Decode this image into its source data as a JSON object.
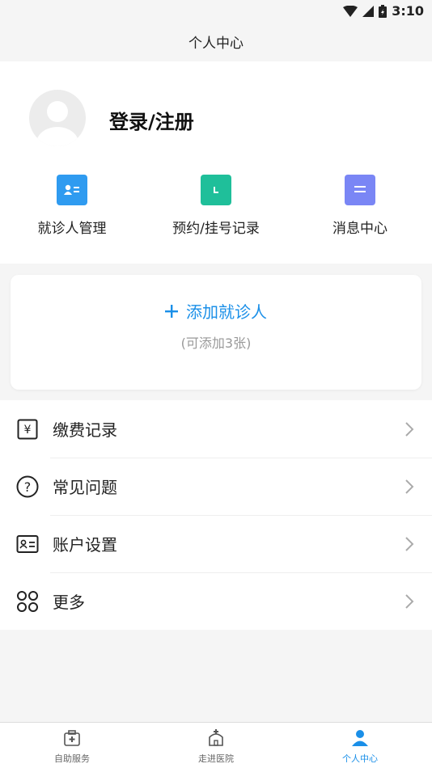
{
  "status": {
    "time": "3:10"
  },
  "header": {
    "title": "个人中心"
  },
  "profile": {
    "login_label": "登录/注册"
  },
  "quick_actions": [
    {
      "label": "就诊人管理",
      "icon": "patient-card-icon",
      "color": "#2f9bf0"
    },
    {
      "label": "预约/挂号记录",
      "icon": "calendar-icon",
      "color": "#1fbf9a"
    },
    {
      "label": "消息中心",
      "icon": "message-icon",
      "color": "#7a86f5"
    }
  ],
  "add_patient": {
    "label": "添加就诊人",
    "hint": "(可添加3张)"
  },
  "menu": [
    {
      "label": "缴费记录",
      "icon": "payment-record-icon"
    },
    {
      "label": "常见问题",
      "icon": "question-icon"
    },
    {
      "label": "账户设置",
      "icon": "account-settings-icon"
    },
    {
      "label": "更多",
      "icon": "more-grid-icon"
    }
  ],
  "tabs": [
    {
      "label": "自助服务",
      "icon": "medical-kit-icon"
    },
    {
      "label": "走进医院",
      "icon": "hospital-icon"
    },
    {
      "label": "个人中心",
      "icon": "user-icon",
      "active": true
    }
  ],
  "colors": {
    "accent": "#1a8fe8"
  }
}
